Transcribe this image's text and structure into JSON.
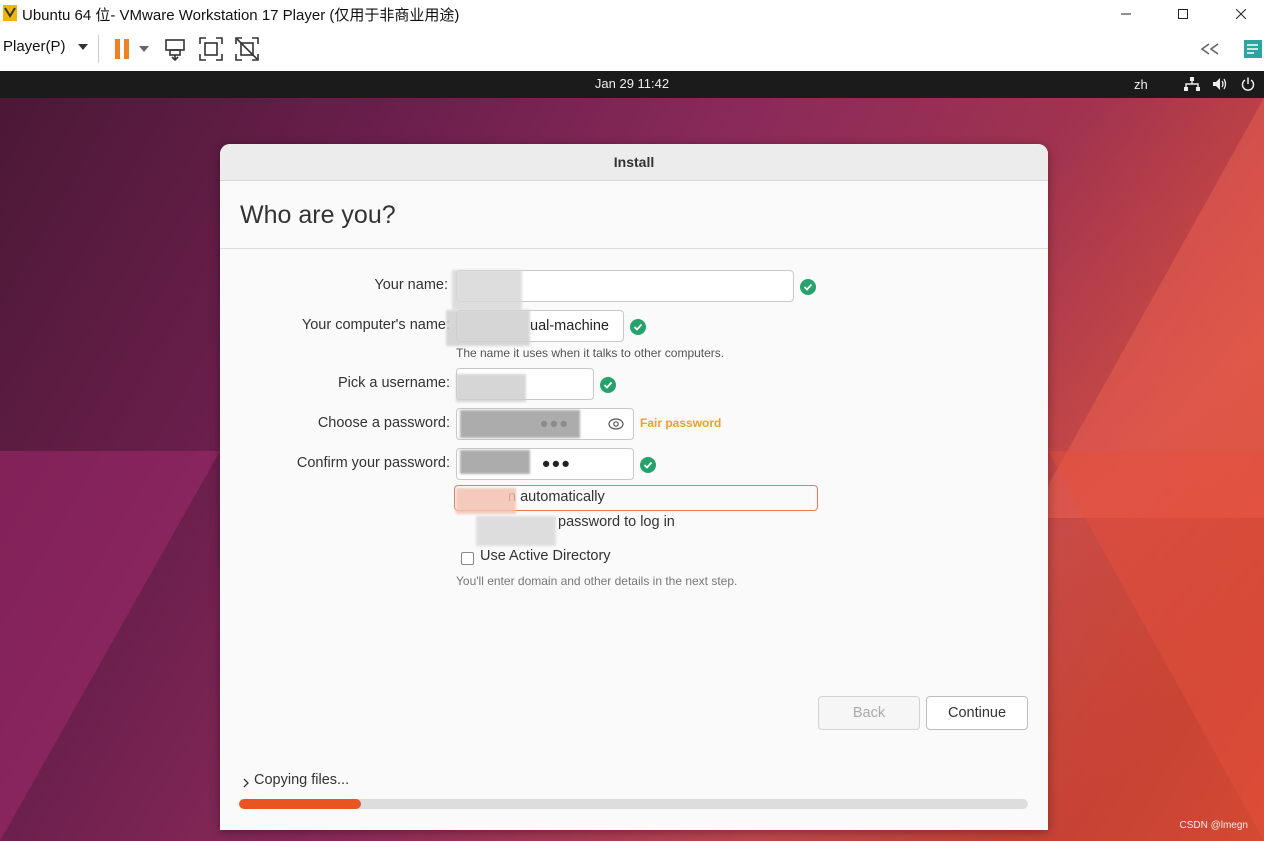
{
  "window": {
    "title": "Ubuntu 64 位- VMware Workstation 17 Player (仅用于非商业用途)",
    "minimize_icon": "minimize-icon",
    "maximize_icon": "maximize-icon",
    "close_icon": "close-icon"
  },
  "toolbar": {
    "player_menu": "Player(P)",
    "icons": [
      "pause-icon",
      "dropdown-icon",
      "send-ctrl-alt-del-icon",
      "fit-guest-icon",
      "unity-icon",
      "collapse-icon",
      "notes-icon"
    ]
  },
  "gnome": {
    "clock": "Jan 29  11:42",
    "lang": "zh",
    "icons": [
      "network-icon",
      "volume-icon",
      "power-icon"
    ]
  },
  "installer": {
    "window_title": "Install",
    "page_title": "Who are you?",
    "fields": {
      "name_label": "Your name:",
      "name_value": "",
      "computer_label": "Your computer's name:",
      "computer_value": "ual-machine",
      "computer_hint": "The name it uses when it talks to other computers.",
      "username_label": "Pick a username:",
      "username_value": "",
      "password_label": "Choose a password:",
      "password_value": "●●●",
      "password_strength": "Fair password",
      "confirm_label": "Confirm your password:",
      "confirm_value": "●●●"
    },
    "options": {
      "login_auto": "n automatically",
      "require_password": "password to log in",
      "active_directory": "Use Active Directory",
      "active_directory_hint": "You'll enter domain and other details in the next step."
    },
    "buttons": {
      "back": "Back",
      "continue": "Continue"
    },
    "status": {
      "copying": "Copying files...",
      "progress": 0.155
    }
  },
  "watermark": "CSDN @lmegn",
  "colors": {
    "accent": "#e95420",
    "ok_green": "#26a26c",
    "strength_orange": "#f0a028"
  }
}
